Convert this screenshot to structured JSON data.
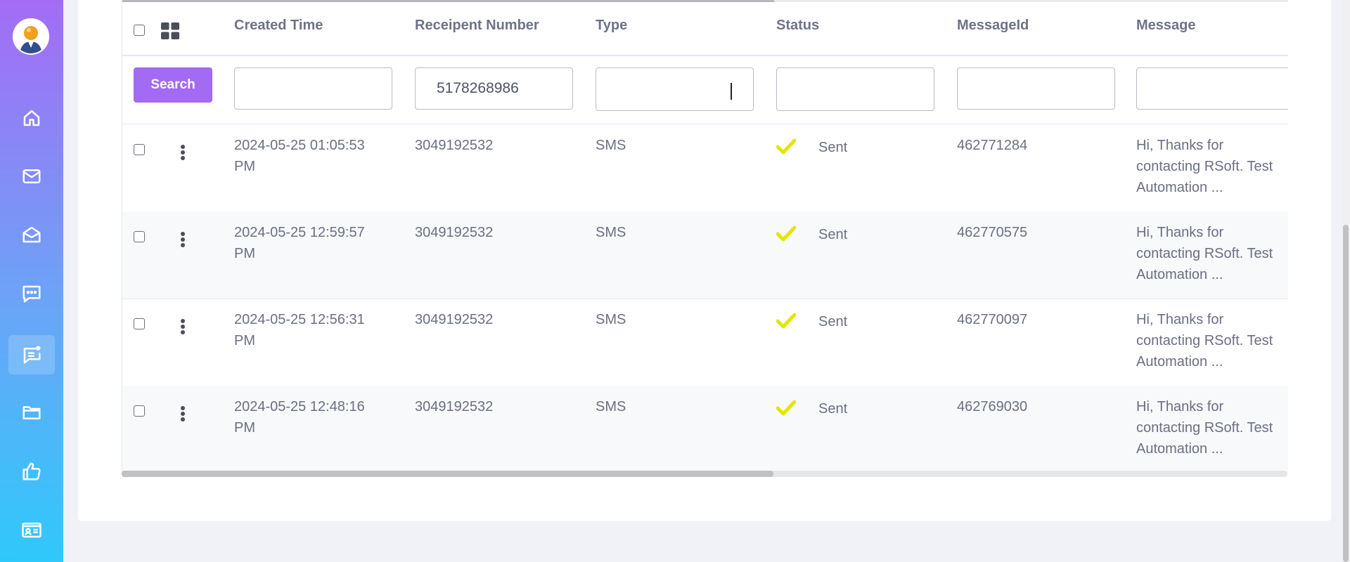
{
  "sidebar": {
    "avatar_icon": "user-avatar-icon",
    "items": [
      {
        "name": "home",
        "icon": "home-icon"
      },
      {
        "name": "mail",
        "icon": "mail-icon"
      },
      {
        "name": "mail-open",
        "icon": "open-mail-icon"
      },
      {
        "name": "chat",
        "icon": "chat-icon"
      },
      {
        "name": "sms-logs",
        "icon": "message-notification-icon",
        "active": true
      },
      {
        "name": "files",
        "icon": "folder-icon"
      },
      {
        "name": "likes",
        "icon": "thumbs-up-icon"
      },
      {
        "name": "contacts",
        "icon": "contact-card-icon"
      }
    ]
  },
  "table": {
    "columns": [
      "Created Time",
      "Receipent Number",
      "Type",
      "Status",
      "MessageId",
      "Message"
    ],
    "search_label": "Search",
    "filters": {
      "created_time": "",
      "recipient_number": "5178268986",
      "type": "",
      "status": "",
      "message_id": "",
      "message": ""
    },
    "rows": [
      {
        "time_line1": "2024-05-25 01:05:53",
        "time_line2": "PM",
        "number": "3049192532",
        "type": "SMS",
        "status": "Sent",
        "message_id": "462771284",
        "msg1": "Hi, Thanks for",
        "msg2": "contacting RSoft. Test",
        "msg3": "Automation ..."
      },
      {
        "time_line1": "2024-05-25 12:59:57",
        "time_line2": "PM",
        "number": "3049192532",
        "type": "SMS",
        "status": "Sent",
        "message_id": "462770575",
        "msg1": "Hi, Thanks for",
        "msg2": "contacting RSoft. Test",
        "msg3": "Automation ..."
      },
      {
        "time_line1": "2024-05-25 12:56:31",
        "time_line2": "PM",
        "number": "3049192532",
        "type": "SMS",
        "status": "Sent",
        "message_id": "462770097",
        "msg1": "Hi, Thanks for",
        "msg2": "contacting RSoft. Test",
        "msg3": "Automation ..."
      },
      {
        "time_line1": "2024-05-25 12:48:16",
        "time_line2": "PM",
        "number": "3049192532",
        "type": "SMS",
        "status": "Sent",
        "message_id": "462769030",
        "msg1": "Hi, Thanks for",
        "msg2": "contacting RSoft. Test",
        "msg3": "Automation ..."
      }
    ]
  },
  "colors": {
    "accent": "#a36af4",
    "status_ok": "#e5e600",
    "sidebar_top": "#a46cf5",
    "sidebar_bottom": "#2fc9fb"
  }
}
